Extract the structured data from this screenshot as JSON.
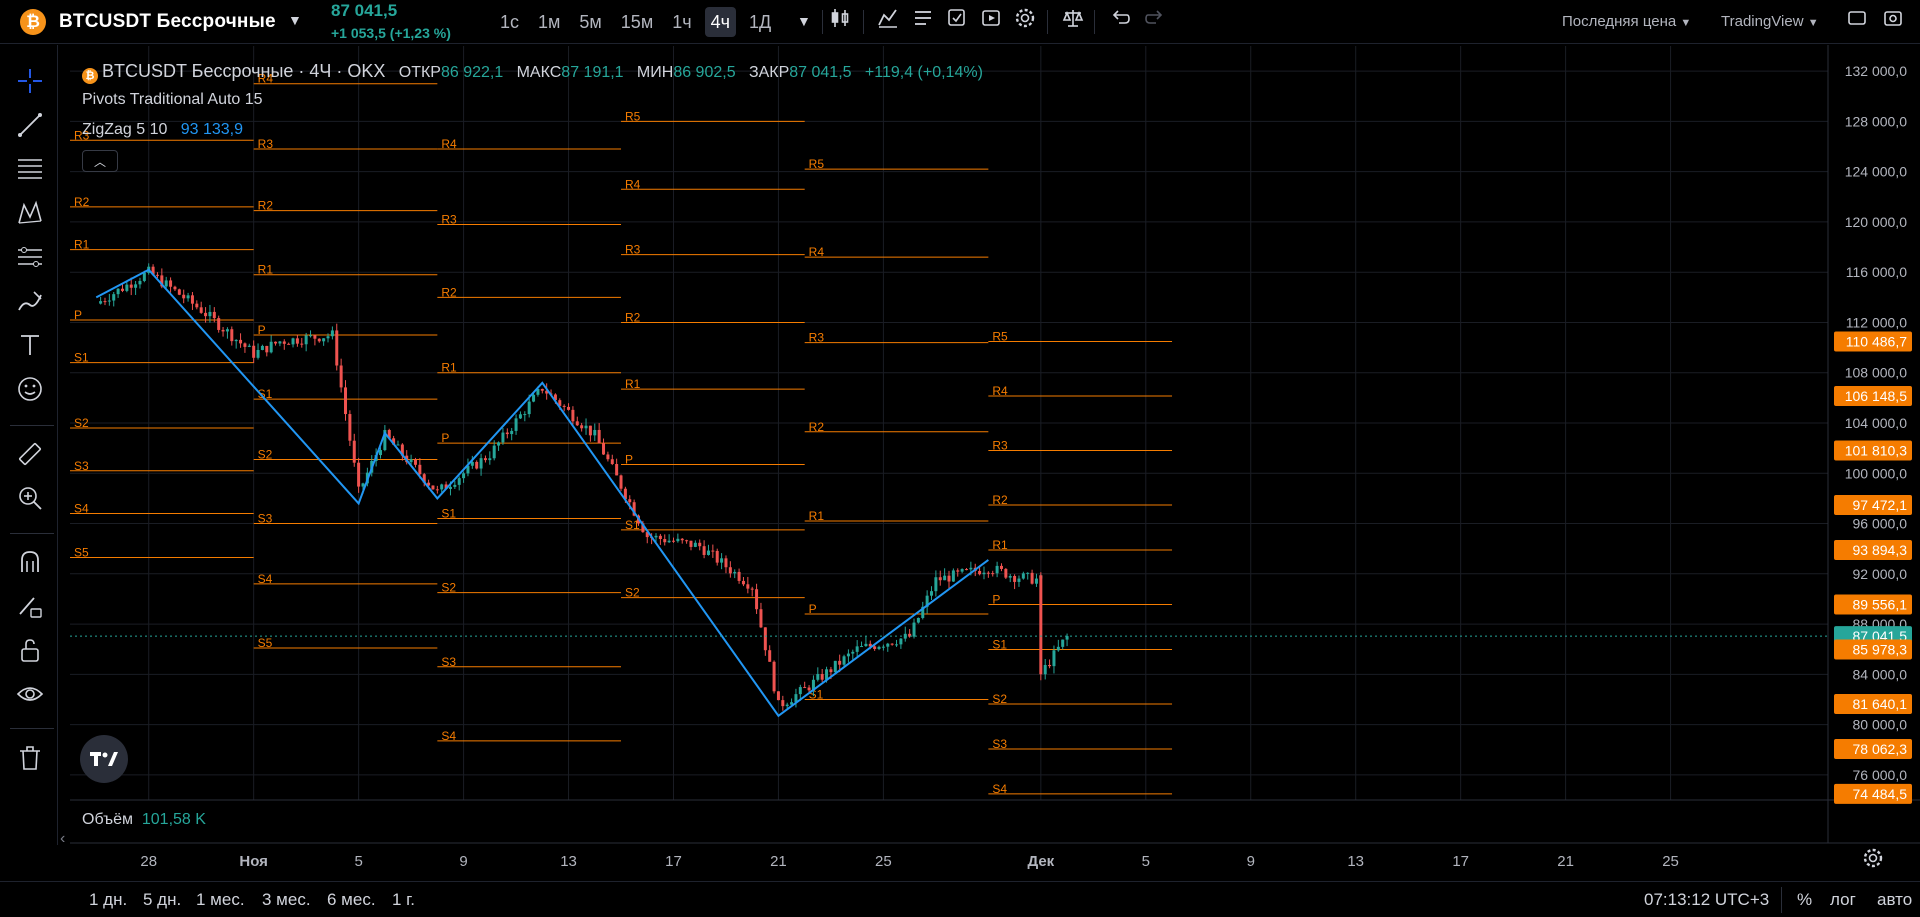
{
  "header": {
    "coin_glyph": "₿",
    "symbol": "BTCUSDT Бессрочные",
    "last_price": "87 041,5",
    "change": "+1 053,5 (+1,23 %)",
    "timeframes": [
      "1с",
      "1м",
      "5м",
      "15м",
      "1ч",
      "4ч",
      "1Д"
    ],
    "active_timeframe": "4ч",
    "price_source": "Последняя цена",
    "broker": "TradingView"
  },
  "legend": {
    "title": "BTCUSDT Бессрочные · 4Ч · OKX",
    "open_label": "ОТКР",
    "open": "86 922,1",
    "high_label": "МАКС",
    "high": "87 191,1",
    "low_label": "МИН",
    "low": "86 902,5",
    "close_label": "ЗАКР",
    "close": "87 041,5",
    "change": "+119,4 (+0,14%)",
    "indicator_pivots": "Pivots Traditional Auto 15",
    "indicator_zigzag": "ZigZag 5 10",
    "zigzag_value": "93 133,9",
    "volume_label": "Объём",
    "volume_value": "101,58 K"
  },
  "colors": {
    "up": "#26a69a",
    "down": "#ef5350",
    "pivot": "#f57c00",
    "zigzag": "#2196f3",
    "grid": "#1a1d24"
  },
  "price_axis": {
    "ticks": [
      "132 000,0",
      "128 000,0",
      "124 000,0",
      "120 000,0",
      "116 000,0",
      "112 000,0",
      "108 000,0",
      "104 000,0",
      "100 000,0",
      "96 000,0",
      "92 000,0",
      "88 000,0",
      "84 000,0",
      "80 000,0",
      "76 000,0"
    ],
    "badges": [
      {
        "text": "110 486,7",
        "price": 110486.7,
        "kind": "pivot"
      },
      {
        "text": "106 148,5",
        "price": 106148.5,
        "kind": "pivot"
      },
      {
        "text": "101 810,3",
        "price": 101810.3,
        "kind": "pivot"
      },
      {
        "text": "97 472,1",
        "price": 97472.1,
        "kind": "pivot"
      },
      {
        "text": "93 894,3",
        "price": 93894.3,
        "kind": "pivot"
      },
      {
        "text": "89 556,1",
        "price": 89556.1,
        "kind": "pivot"
      },
      {
        "text": "87 041,5",
        "price": 87041.5,
        "kind": "last"
      },
      {
        "text": "85 978,3",
        "price": 85978.3,
        "kind": "pivot"
      },
      {
        "text": "81 640,1",
        "price": 81640.1,
        "kind": "pivot"
      },
      {
        "text": "78 062,3",
        "price": 78062.3,
        "kind": "pivot"
      },
      {
        "text": "74 484,5",
        "price": 74484.5,
        "kind": "pivot"
      }
    ]
  },
  "time_axis": {
    "ticks": [
      "28",
      "Ноя",
      "5",
      "9",
      "13",
      "17",
      "21",
      "25",
      "Дек",
      "5",
      "9",
      "13",
      "17",
      "21",
      "25"
    ]
  },
  "pivot_labels": [
    "R5",
    "R4",
    "R3",
    "R2",
    "R1",
    "P",
    "S1",
    "S2",
    "S3",
    "S4",
    "S5"
  ],
  "bottom": {
    "ranges": [
      "1 дн.",
      "5 дн.",
      "1 мес.",
      "3 мес.",
      "6 мес.",
      "1 г."
    ],
    "clock": "07:13:12 UTC+3",
    "percent": "%",
    "log": "лог",
    "auto": "авто"
  },
  "chart_data": {
    "type": "candlestick",
    "y_unit": "USDT",
    "ylim": [
      74000,
      134000
    ],
    "pivot_periods": [
      {
        "start": "2024-10-25",
        "end": "2024-11-01",
        "levels": {
          "R3": 126500,
          "R2": 121200,
          "R1": 117800,
          "P": 112200,
          "S1": 108800,
          "S2": 103600,
          "S3": 100200,
          "S4": 96800,
          "S5": 93300
        }
      },
      {
        "start": "2024-11-01",
        "end": "2024-11-08",
        "levels": {
          "R4": 131000,
          "R3": 125800,
          "R2": 120900,
          "R1": 115800,
          "P": 111000,
          "S1": 105900,
          "S2": 101100,
          "S3": 96000,
          "S4": 91200,
          "S5": 86100
        }
      },
      {
        "start": "2024-11-08",
        "end": "2024-11-15",
        "levels": {
          "R4": 125800,
          "R3": 119800,
          "R2": 114000,
          "R1": 108000,
          "P": 102400,
          "S1": 96400,
          "S2": 90500,
          "S3": 84600,
          "S4": 78700,
          "S5": 72700
        }
      },
      {
        "start": "2024-11-15",
        "end": "2024-11-22",
        "levels": {
          "R5": 128000,
          "R4": 122600,
          "R3": 117400,
          "R2": 112000,
          "R1": 106700,
          "P": 100700,
          "S1": 95500,
          "S2": 90100
        }
      },
      {
        "start": "2024-11-22",
        "end": "2024-11-29",
        "levels": {
          "R5": 124200,
          "R4": 117200,
          "R3": 110400,
          "R2": 103300,
          "R1": 96200,
          "P": 88800,
          "S1": 82000
        }
      },
      {
        "start": "2024-11-29",
        "end": "2024-12-06",
        "levels": {
          "R5": 110486.7,
          "R4": 106148.5,
          "R3": 101810.3,
          "R2": 97472.1,
          "R1": 93894.3,
          "P": 89556.1,
          "S1": 85978.3,
          "S2": 81640.1,
          "S3": 78062.3,
          "S4": 74484.5
        }
      }
    ],
    "zigzag": [
      {
        "date": "2024-10-26",
        "price": 114000
      },
      {
        "date": "2024-10-28",
        "price": 116200
      },
      {
        "date": "2024-11-05",
        "price": 97600
      },
      {
        "date": "2024-11-06",
        "price": 103200
      },
      {
        "date": "2024-11-08",
        "price": 98000
      },
      {
        "date": "2024-11-12",
        "price": 107200
      },
      {
        "date": "2024-11-21",
        "price": 80700
      },
      {
        "date": "2024-11-29",
        "price": 93100
      }
    ],
    "close_path": [
      {
        "date": "2024-10-26",
        "price": 113500
      },
      {
        "date": "2024-10-28",
        "price": 116000
      },
      {
        "date": "2024-10-30",
        "price": 113000
      },
      {
        "date": "2024-11-01",
        "price": 109500
      },
      {
        "date": "2024-11-02",
        "price": 110500
      },
      {
        "date": "2024-11-04",
        "price": 111000
      },
      {
        "date": "2024-11-05",
        "price": 98500
      },
      {
        "date": "2024-11-06",
        "price": 103000
      },
      {
        "date": "2024-11-08",
        "price": 98500
      },
      {
        "date": "2024-11-10",
        "price": 101500
      },
      {
        "date": "2024-11-12",
        "price": 106800
      },
      {
        "date": "2024-11-14",
        "price": 103000
      },
      {
        "date": "2024-11-16",
        "price": 95000
      },
      {
        "date": "2024-11-18",
        "price": 94200
      },
      {
        "date": "2024-11-20",
        "price": 91000
      },
      {
        "date": "2024-11-21",
        "price": 81500
      },
      {
        "date": "2024-11-22",
        "price": 82800
      },
      {
        "date": "2024-11-24",
        "price": 86000
      },
      {
        "date": "2024-11-26",
        "price": 87000
      },
      {
        "date": "2024-11-27",
        "price": 91500
      },
      {
        "date": "2024-11-29",
        "price": 92500
      },
      {
        "date": "2024-11-30",
        "price": 91800
      },
      {
        "date": "2024-12-01",
        "price": 91500
      },
      {
        "date": "2024-12-01",
        "price": 84000
      },
      {
        "date": "2024-12-02",
        "price": 87041.5
      }
    ]
  }
}
